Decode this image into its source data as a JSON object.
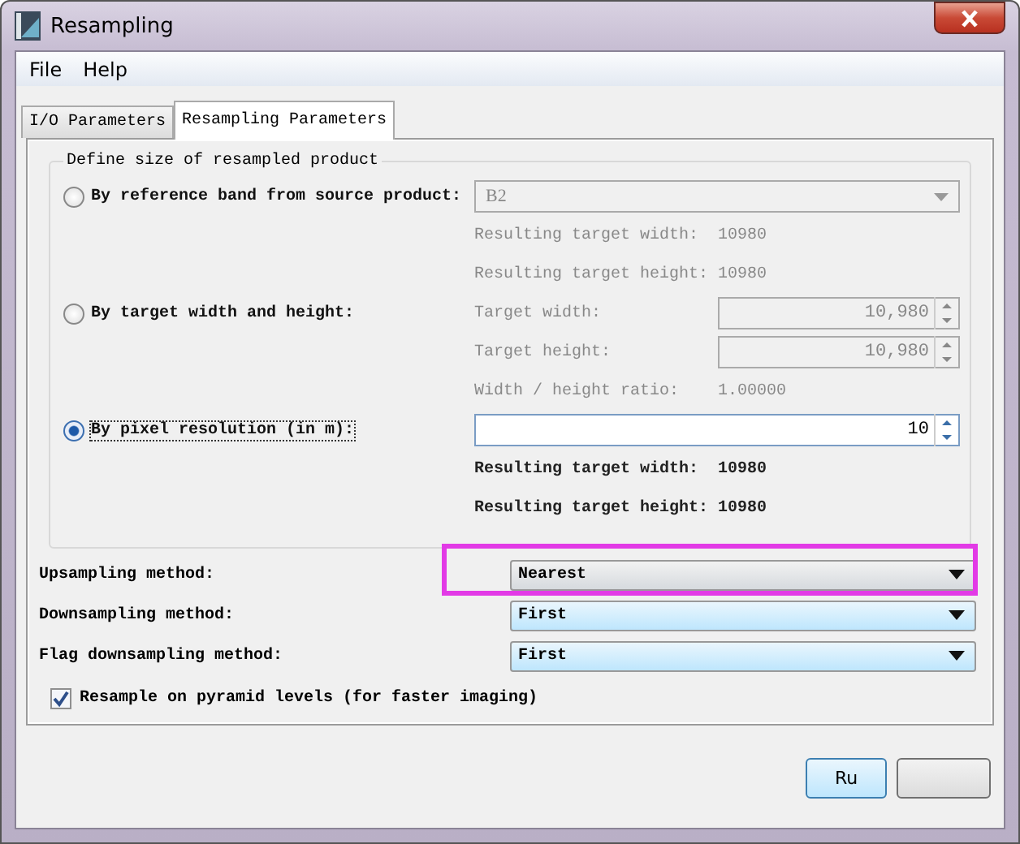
{
  "window": {
    "title": "Resampling"
  },
  "menu": [
    "File",
    "Help"
  ],
  "tabs": [
    {
      "label": "I/O Parameters",
      "selected": false
    },
    {
      "label": "Resampling Parameters",
      "selected": true
    }
  ],
  "size_group": {
    "title": "Define size of resampled product",
    "options": [
      {
        "kind": "band",
        "label": "By reference band from source product:",
        "selected": false,
        "band": "B2",
        "readouts": [
          {
            "label": "Resulting target width:",
            "value": "10980"
          },
          {
            "label": "Resulting target height:",
            "value": "10980"
          }
        ]
      },
      {
        "kind": "size",
        "label": "By target width and height:",
        "selected": false,
        "fields": [
          {
            "label": "Target width:",
            "value": "10,980"
          },
          {
            "label": "Target height:",
            "value": "10,980"
          }
        ],
        "readouts": [
          {
            "label": "Width / height ratio:",
            "value": "1.00000"
          }
        ]
      },
      {
        "kind": "resolution",
        "label": "By pixel resolution (in m):",
        "selected": true,
        "value": "10",
        "readouts": [
          {
            "label": "Resulting target width:",
            "value": "10980"
          },
          {
            "label": "Resulting target height:",
            "value": "10980"
          }
        ]
      }
    ]
  },
  "methods": [
    {
      "label": "Upsampling method:",
      "value": "Nearest",
      "highlighted": true
    },
    {
      "label": "Downsampling method:",
      "value": "First",
      "highlighted": false
    },
    {
      "label": "Flag downsampling method:",
      "value": "First",
      "highlighted": false
    }
  ],
  "pyramid": {
    "label": "Resample on pyramid levels (for faster imaging)",
    "checked": true
  },
  "buttons": [
    "Ru"
  ]
}
